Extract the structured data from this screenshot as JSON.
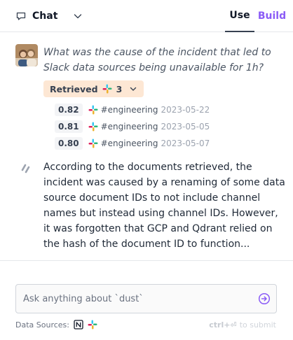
{
  "header": {
    "mode_label": "Chat",
    "tabs": [
      {
        "label": "Use",
        "active": true
      },
      {
        "label": "Build",
        "active": false
      }
    ]
  },
  "conversation": {
    "question": "What was the cause of the incident that led to Slack data sources being unavailable for 1h?",
    "retrieved": {
      "label": "Retrieved",
      "count": "3",
      "documents": [
        {
          "score": "0.82",
          "channel": "#engineering",
          "date": "2023-05-22"
        },
        {
          "score": "0.81",
          "channel": "#engineering",
          "date": "2023-05-05"
        },
        {
          "score": "0.80",
          "channel": "#engineering",
          "date": "2023-05-07"
        }
      ]
    },
    "answer": "According to the documents retrieved, the incident was caused by a renaming of some data source document IDs to not include channel names but instead using channel IDs. However, it was forgotten that GCP and Qdrant relied on the hash of the document ID to function..."
  },
  "composer": {
    "placeholder": "Ask anything about `dust`",
    "sources_label": "Data Sources:",
    "shortcut": "ctrl+⏎",
    "submit_hint": "to submit"
  },
  "colors": {
    "accent": "#8b5cf6",
    "retrieved_chip_bg": "#fde7d4"
  },
  "icons": [
    "chat-bubble-icon",
    "chevron-down-icon",
    "slack-icon",
    "notion-icon",
    "dust-agent-icon",
    "send-arrow-icon"
  ]
}
